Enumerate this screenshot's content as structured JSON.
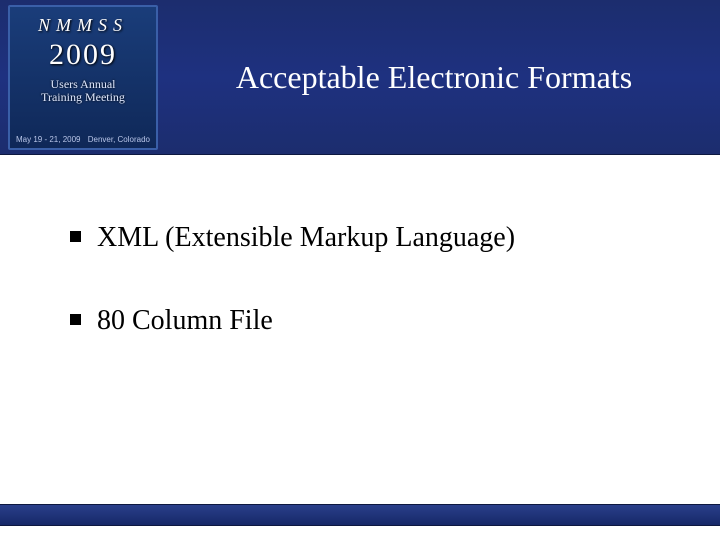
{
  "logo": {
    "acronym": "NMMSS",
    "year": "2009",
    "subtitle_line1": "Users Annual",
    "subtitle_line2": "Training Meeting",
    "date": "May 19 - 21, 2009",
    "location": "Denver, Colorado"
  },
  "slide": {
    "title": "Acceptable Electronic Formats",
    "bullets": [
      "XML (Extensible Markup Language)",
      "80 Column File"
    ]
  }
}
